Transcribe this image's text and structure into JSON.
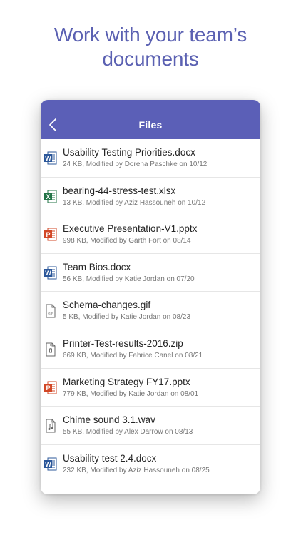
{
  "headline": {
    "line1": "Work with your team’s",
    "line2": "documents"
  },
  "nav": {
    "title": "Files"
  },
  "colors": {
    "headline": "#5b61b2",
    "nav_bar": "#5b5fb7",
    "word": "#2b579a",
    "excel": "#217346",
    "powerpoint": "#d24726",
    "generic": "#666666"
  },
  "files": [
    {
      "name": "Usability Testing Priorities.docx",
      "meta": "24 KB, Modified by Dorena Paschke on 10/12",
      "type": "word"
    },
    {
      "name": "bearing-44-stress-test.xlsx",
      "meta": "13 KB, Modified by Aziz Hassouneh on 10/12",
      "type": "excel"
    },
    {
      "name": "Executive Presentation-V1.pptx",
      "meta": "998 KB, Modified by Garth Fort on 08/14",
      "type": "powerpoint"
    },
    {
      "name": "Team Bios.docx",
      "meta": "56 KB, Modified by Katie Jordan on 07/20",
      "type": "word"
    },
    {
      "name": "Schema-changes.gif",
      "meta": "5 KB, Modified by Katie Jordan on 08/23",
      "type": "gif"
    },
    {
      "name": "Printer-Test-results-2016.zip",
      "meta": "669 KB, Modified by Fabrice Canel on 08/21",
      "type": "zip"
    },
    {
      "name": "Marketing Strategy FY17.pptx",
      "meta": "779 KB, Modified by Katie Jordan on 08/01",
      "type": "powerpoint"
    },
    {
      "name": "Chime sound 3.1.wav",
      "meta": "55 KB, Modified by Alex Darrow on 08/13",
      "type": "audio"
    },
    {
      "name": "Usability test 2.4.docx",
      "meta": "232 KB, Modified by Aziz Hassouneh on 08/25",
      "type": "word"
    }
  ]
}
